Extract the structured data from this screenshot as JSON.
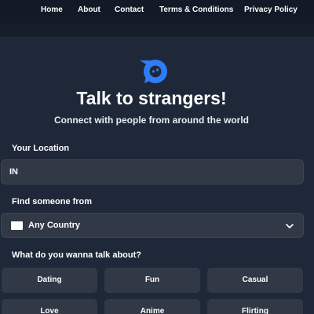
{
  "nav": {
    "items": [
      {
        "label": "Home"
      },
      {
        "label": "About"
      },
      {
        "label": "Contact"
      },
      {
        "label": "Terms & Conditions"
      },
      {
        "label": "Privacy Policy"
      }
    ]
  },
  "hero": {
    "title": "Talk to strangers!",
    "subtitle": "Connect with people from around the world",
    "logo_icon": "chat-bubble-logo-icon",
    "accent_color": "#2f7df6"
  },
  "location": {
    "label": "Your Location",
    "value": "IN"
  },
  "find": {
    "label": "Find someone from",
    "selected": "Any Country",
    "flag_icon": "white-flag-icon",
    "chevron_icon": "chevron-down-icon"
  },
  "topics": {
    "label": "What do you wanna talk about?",
    "items": [
      {
        "label": "Dating"
      },
      {
        "label": "Fun"
      },
      {
        "label": "Casual"
      },
      {
        "label": "Love"
      },
      {
        "label": "Anime"
      },
      {
        "label": "Flirting"
      }
    ]
  },
  "colors": {
    "background": "#1f2838",
    "nav_background": "#131a27",
    "field_background": "#313846"
  }
}
